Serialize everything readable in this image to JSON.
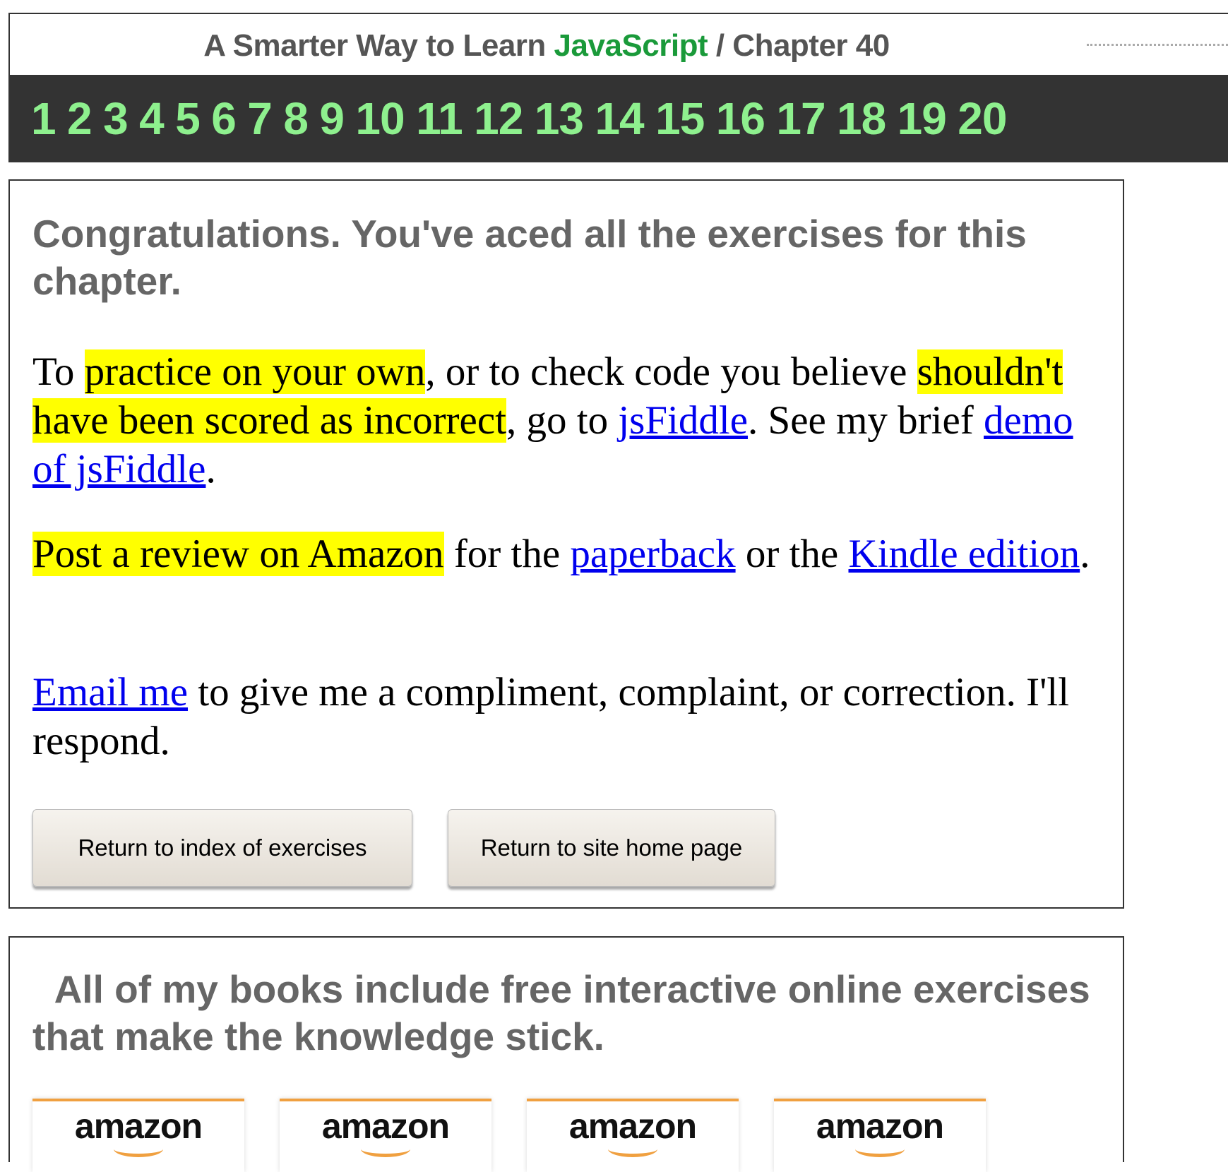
{
  "header": {
    "title_prefix": "A Smarter Way to Learn",
    "title_brand": "JavaScript",
    "title_suffix": "/  Chapter 40"
  },
  "chapter_nav": [
    "1",
    "2",
    "3",
    "4",
    "5",
    "6",
    "7",
    "8",
    "9",
    "10",
    "11",
    "12",
    "13",
    "14",
    "15",
    "16",
    "17",
    "18",
    "19",
    "20"
  ],
  "colors": {
    "brand_green": "#1a9a3a",
    "nav_green": "#8ef08e",
    "highlight": "#ffff00",
    "link": "#0000ee"
  },
  "congrats": {
    "heading": "Congratulations. You've aced all the exercises for this chapter.",
    "p1_start": "To ",
    "p1_hl1": "practice on your own",
    "p1_mid": ", or to check code you believe ",
    "p1_hl2": "shouldn't have been scored as incorrect",
    "p1_mid2": ", go to ",
    "p1_link1": "jsFiddle",
    "p1_mid3": ". See my brief ",
    "p1_link2": "demo of jsFiddle",
    "p1_end": ".",
    "p2_hl": "Post a review on Amazon",
    "p2_mid": " for the ",
    "p2_link1": "paperback",
    "p2_mid2": " or the ",
    "p2_link2": "Kindle edition",
    "p2_end": ".",
    "p3_link": "Email me",
    "p3_rest": " to give me a compliment, complaint, or correction. I'll respond.",
    "button_index": "Return to index of exercises",
    "button_home": "Return to site home page"
  },
  "books": {
    "heading": "All of my books include free interactive online exercises that make the knowledge stick.",
    "amazon_badges": [
      "amazon",
      "amazon",
      "amazon",
      "amazon"
    ]
  }
}
